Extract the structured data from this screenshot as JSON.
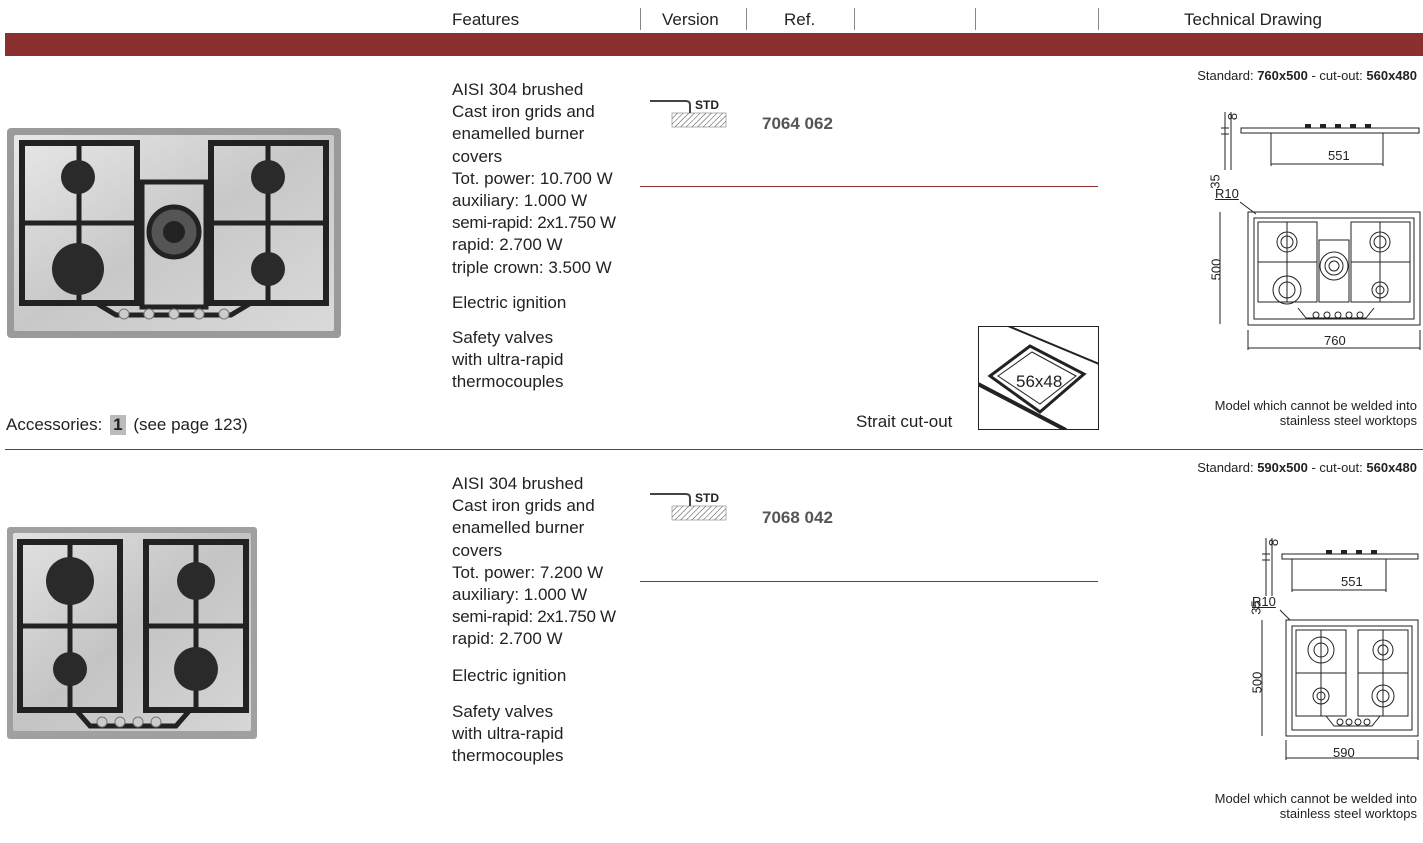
{
  "header": {
    "features": "Features",
    "version": "Version",
    "ref": "Ref.",
    "technical_drawing": "Technical Drawing"
  },
  "products": [
    {
      "features": [
        "AISI 304 brushed",
        "Cast iron grids and",
        "enamelled burner",
        "covers",
        "Tot. power: 10.700 W",
        "auxiliary: 1.000 W",
        "semi-rapid: 2x1.750 W",
        "rapid: 2.700 W",
        "triple crown: 3.500 W"
      ],
      "ignition": "Electric ignition",
      "safety": [
        "Safety valves",
        "with ultra-rapid",
        "thermocouples"
      ],
      "version_badge": "STD",
      "ref": "7064 062",
      "standard_label": "Standard:",
      "standard_size": "760x500",
      "cutout_label": "- cut-out:",
      "cutout_size": "560x480",
      "dim_height_small": "8",
      "dim_height": "35",
      "dim_inner": "551",
      "radius": "R10",
      "depth": "500",
      "width": "760",
      "note": [
        "Model which cannot be welded into",
        "stainless steel worktops"
      ],
      "cutout_title": "Strait cut-out",
      "cutout_value": "56x48",
      "accessories_label": "Accessories:",
      "accessories_num": "1",
      "accessories_page": "(see page 123)"
    },
    {
      "features": [
        "AISI 304 brushed",
        "Cast iron grids and",
        "enamelled burner",
        "covers",
        "Tot. power: 7.200 W",
        "auxiliary: 1.000 W",
        "semi-rapid: 2x1.750 W",
        "rapid: 2.700 W"
      ],
      "ignition": "Electric ignition",
      "safety": [
        "Safety valves",
        "with ultra-rapid",
        "thermocouples"
      ],
      "version_badge": "STD",
      "ref": "7068 042",
      "standard_label": "Standard:",
      "standard_size": "590x500",
      "cutout_label": "- cut-out:",
      "cutout_size": "560x480",
      "dim_height_small": "8",
      "dim_height": "35",
      "dim_inner": "551",
      "radius": "R10",
      "depth": "500",
      "width": "590",
      "note": [
        "Model which cannot be welded into",
        "stainless steel worktops"
      ]
    }
  ]
}
